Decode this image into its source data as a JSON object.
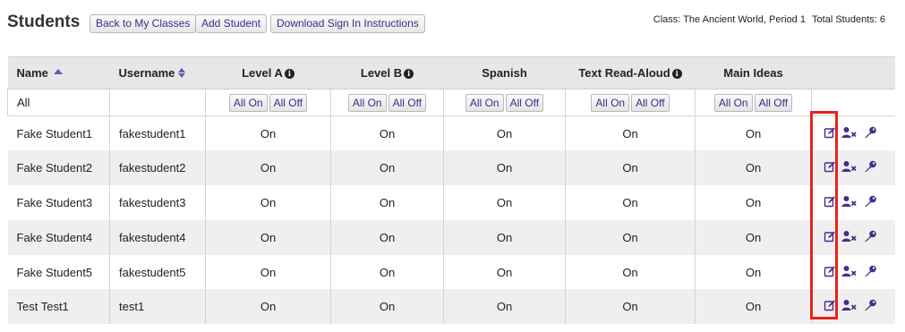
{
  "page": {
    "title": "Students",
    "buttons": {
      "back": "Back to My Classes",
      "add": "Add Student",
      "download": "Download Sign In Instructions"
    },
    "class_info": "Class: The Ancient World, Period 1",
    "total_info": "Total Students: 6"
  },
  "table": {
    "headers": {
      "name": "Name",
      "username": "Username",
      "level_a": "Level A",
      "level_b": "Level B",
      "spanish": "Spanish",
      "text_read_aloud": "Text Read-Aloud",
      "main_ideas": "Main Ideas"
    },
    "filter": {
      "label": "All",
      "all_on": "All On",
      "all_off": "All Off"
    },
    "rows": [
      {
        "name": "Fake Student1",
        "username": "fakestudent1",
        "level_a": "On",
        "level_b": "On",
        "spanish": "On",
        "tra": "On",
        "main_ideas": "On"
      },
      {
        "name": "Fake Student2",
        "username": "fakestudent2",
        "level_a": "On",
        "level_b": "On",
        "spanish": "On",
        "tra": "On",
        "main_ideas": "On"
      },
      {
        "name": "Fake Student3",
        "username": "fakestudent3",
        "level_a": "On",
        "level_b": "On",
        "spanish": "On",
        "tra": "On",
        "main_ideas": "On"
      },
      {
        "name": "Fake Student4",
        "username": "fakestudent4",
        "level_a": "On",
        "level_b": "On",
        "spanish": "On",
        "tra": "On",
        "main_ideas": "On"
      },
      {
        "name": "Fake Student5",
        "username": "fakestudent5",
        "level_a": "On",
        "level_b": "On",
        "spanish": "On",
        "tra": "On",
        "main_ideas": "On"
      },
      {
        "name": "Test Test1",
        "username": "test1",
        "level_a": "On",
        "level_b": "On",
        "spanish": "On",
        "tra": "On",
        "main_ideas": "On"
      }
    ],
    "row_actions": [
      "edit-icon",
      "remove-user-icon",
      "key-icon"
    ]
  },
  "colors": {
    "accent": "#3b2a8c",
    "icon": "#4a2a8c",
    "highlight": "#e8221a",
    "header_bg": "#e7e7e7",
    "stripe_bg": "#efefef"
  }
}
